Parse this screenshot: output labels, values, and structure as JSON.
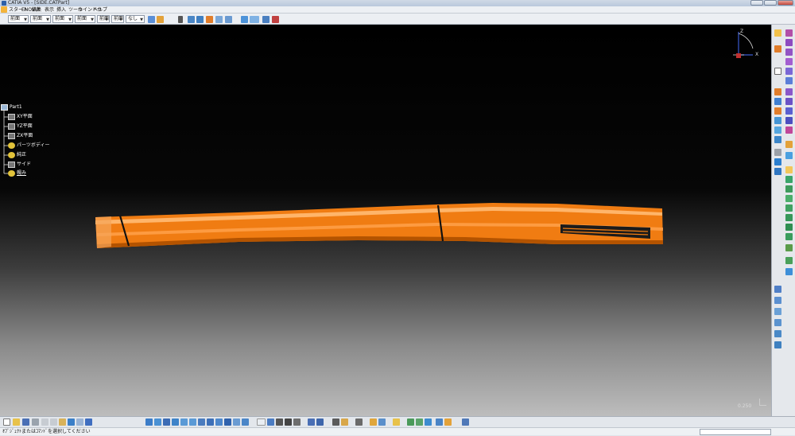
{
  "window": {
    "title": "CATIA V5 - [SIDE.CATPart]"
  },
  "menu": [
    "スタート",
    "ENOVIA",
    "編集",
    "表示",
    "挿入",
    "ツール",
    "ウインドウ",
    "ヘルプ"
  ],
  "options": {
    "selects": [
      "前面",
      "前面",
      "前面",
      "前面",
      "前面",
      "前面",
      "なし"
    ]
  },
  "tree": {
    "root": "Part1",
    "items": [
      {
        "label": "XY平面",
        "icon": "plane-icon"
      },
      {
        "label": "YZ平面",
        "icon": "plane-icon"
      },
      {
        "label": "ZX平面",
        "icon": "plane-icon"
      },
      {
        "label": "パーツボディー",
        "icon": "gear-icon"
      },
      {
        "label": "純正",
        "icon": "gear-icon"
      },
      {
        "label": "サイド",
        "icon": "plane-icon"
      },
      {
        "label": "幌み",
        "icon": "gear-icon"
      }
    ]
  },
  "compass": {
    "z": "Z",
    "x": "X"
  },
  "scale": "0.250",
  "status": {
    "message": "ｵﾌﾞｼﾞｪｸﾄまたはｺﾏﾝﾄﾞを選択してください"
  },
  "colors": {
    "part": "#f07c12",
    "part_highlight": "#ffb56a",
    "part_shadow": "#b35300"
  }
}
